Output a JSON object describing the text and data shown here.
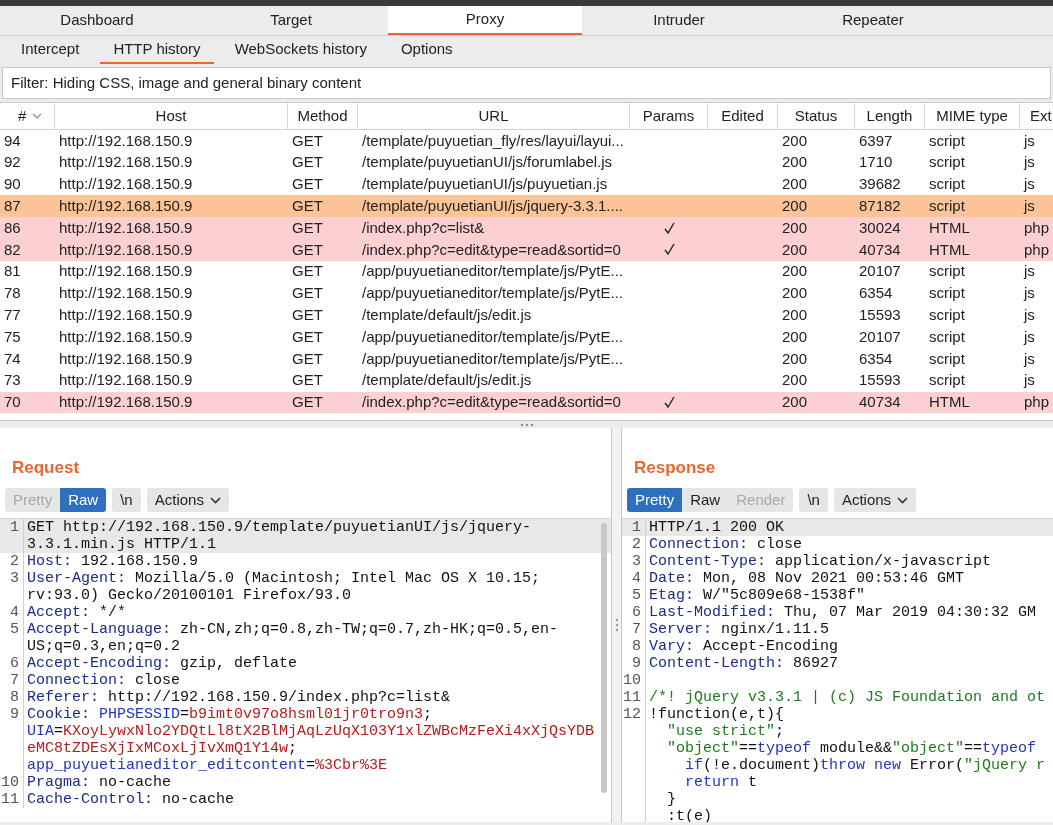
{
  "main_tabs": [
    {
      "label": "Dashboard",
      "selected": false
    },
    {
      "label": "Target",
      "selected": false
    },
    {
      "label": "Proxy",
      "selected": true
    },
    {
      "label": "Intruder",
      "selected": false
    },
    {
      "label": "Repeater",
      "selected": false
    }
  ],
  "sub_tabs": [
    {
      "label": "Intercept",
      "selected": false
    },
    {
      "label": "HTTP history",
      "selected": true
    },
    {
      "label": "WebSockets history",
      "selected": false
    },
    {
      "label": "Options",
      "selected": false
    }
  ],
  "filter": "Filter: Hiding CSS, image and general binary content",
  "table": {
    "columns": [
      "#",
      "Host",
      "Method",
      "URL",
      "Params",
      "Edited",
      "Status",
      "Length",
      "MIME type",
      "Ext"
    ],
    "rows": [
      {
        "id": "94",
        "host": "http://192.168.150.9",
        "method": "GET",
        "url": "/template/puyuetian_fly/res/layui/layui...",
        "params": false,
        "status": "200",
        "length": "6397",
        "mime": "script",
        "ext": "js",
        "color": "#ffffff"
      },
      {
        "id": "92",
        "host": "http://192.168.150.9",
        "method": "GET",
        "url": "/template/puyuetianUI/js/forumlabel.js",
        "params": false,
        "status": "200",
        "length": "1710",
        "mime": "script",
        "ext": "js",
        "color": "#ffffff"
      },
      {
        "id": "90",
        "host": "http://192.168.150.9",
        "method": "GET",
        "url": "/template/puyuetianUI/js/puyuetian.js",
        "params": false,
        "status": "200",
        "length": "39682",
        "mime": "script",
        "ext": "js",
        "color": "#ffffff"
      },
      {
        "id": "87",
        "host": "http://192.168.150.9",
        "method": "GET",
        "url": "/template/puyuetianUI/js/jquery-3.3.1....",
        "params": false,
        "status": "200",
        "length": "87182",
        "mime": "script",
        "ext": "js",
        "color": "#fcc396"
      },
      {
        "id": "86",
        "host": "http://192.168.150.9",
        "method": "GET",
        "url": "/index.php?c=list&",
        "params": true,
        "status": "200",
        "length": "30024",
        "mime": "HTML",
        "ext": "php",
        "color": "#fcd0d0"
      },
      {
        "id": "82",
        "host": "http://192.168.150.9",
        "method": "GET",
        "url": "/index.php?c=edit&type=read&sortid=0",
        "params": true,
        "status": "200",
        "length": "40734",
        "mime": "HTML",
        "ext": "php",
        "color": "#fcd0d0"
      },
      {
        "id": "81",
        "host": "http://192.168.150.9",
        "method": "GET",
        "url": "/app/puyuetianeditor/template/js/PytE...",
        "params": false,
        "status": "200",
        "length": "20107",
        "mime": "script",
        "ext": "js",
        "color": "#ffffff"
      },
      {
        "id": "78",
        "host": "http://192.168.150.9",
        "method": "GET",
        "url": "/app/puyuetianeditor/template/js/PytE...",
        "params": false,
        "status": "200",
        "length": "6354",
        "mime": "script",
        "ext": "js",
        "color": "#ffffff"
      },
      {
        "id": "77",
        "host": "http://192.168.150.9",
        "method": "GET",
        "url": "/template/default/js/edit.js",
        "params": false,
        "status": "200",
        "length": "15593",
        "mime": "script",
        "ext": "js",
        "color": "#ffffff"
      },
      {
        "id": "75",
        "host": "http://192.168.150.9",
        "method": "GET",
        "url": "/app/puyuetianeditor/template/js/PytE...",
        "params": false,
        "status": "200",
        "length": "20107",
        "mime": "script",
        "ext": "js",
        "color": "#ffffff"
      },
      {
        "id": "74",
        "host": "http://192.168.150.9",
        "method": "GET",
        "url": "/app/puyuetianeditor/template/js/PytE...",
        "params": false,
        "status": "200",
        "length": "6354",
        "mime": "script",
        "ext": "js",
        "color": "#ffffff"
      },
      {
        "id": "73",
        "host": "http://192.168.150.9",
        "method": "GET",
        "url": "/template/default/js/edit.js",
        "params": false,
        "status": "200",
        "length": "15593",
        "mime": "script",
        "ext": "js",
        "color": "#ffffff"
      },
      {
        "id": "70",
        "host": "http://192.168.150.9",
        "method": "GET",
        "url": "/index.php?c=edit&type=read&sortid=0",
        "params": true,
        "status": "200",
        "length": "40734",
        "mime": "HTML",
        "ext": "php",
        "color": "#fcd0d0"
      }
    ]
  },
  "panes": [
    {
      "title": "Request",
      "buttons": [
        {
          "label": "Pretty",
          "selected": false,
          "disabled": true
        },
        {
          "label": "Raw",
          "selected": true,
          "disabled": false
        },
        {
          "label": "\\n",
          "selected": false,
          "disabled": false
        },
        {
          "label": "Actions",
          "selected": false,
          "disabled": false,
          "dropdown": true
        }
      ],
      "wrap": true,
      "lines": [
        {
          "number": "1",
          "parts": [
            {
              "kind": "plain",
              "text": "GET http://192.168.150.9/template/puyuetianUI/js/jquery-3.3.1.min.js HTTP/1.1"
            }
          ]
        },
        {
          "number": "2",
          "parts": [
            {
              "kind": "header",
              "text": "Host:"
            },
            {
              "kind": "plain",
              "text": " 192.168.150.9"
            }
          ]
        },
        {
          "number": "3",
          "parts": [
            {
              "kind": "header",
              "text": "User-Agent:"
            },
            {
              "kind": "plain",
              "text": " Mozilla/5.0 (Macintosh; Intel Mac OS X 10.15; rv:93.0) Gecko/20100101 Firefox/93.0"
            }
          ]
        },
        {
          "number": "4",
          "parts": [
            {
              "kind": "header",
              "text": "Accept:"
            },
            {
              "kind": "plain",
              "text": " */*"
            }
          ]
        },
        {
          "number": "5",
          "parts": [
            {
              "kind": "header",
              "text": "Accept-Language:"
            },
            {
              "kind": "plain",
              "text": " zh-CN,zh;q=0.8,zh-TW;q=0.7,zh-HK;q=0.5,en-US;q=0.3,en;q=0.2"
            }
          ]
        },
        {
          "number": "6",
          "parts": [
            {
              "kind": "header",
              "text": "Accept-Encoding:"
            },
            {
              "kind": "plain",
              "text": " gzip, deflate"
            }
          ]
        },
        {
          "number": "7",
          "parts": [
            {
              "kind": "header",
              "text": "Connection:"
            },
            {
              "kind": "plain",
              "text": " close"
            }
          ]
        },
        {
          "number": "8",
          "parts": [
            {
              "kind": "header",
              "text": "Referer:"
            },
            {
              "kind": "plain",
              "text": " http://192.168.150.9/index.php?c=list&"
            }
          ]
        },
        {
          "number": "9",
          "parts": [
            {
              "kind": "header",
              "text": "Cookie:"
            },
            {
              "kind": "cookie_name",
              "text": " PHPSESSID"
            },
            {
              "kind": "plain",
              "text": "="
            },
            {
              "kind": "cookie_value",
              "text": "b9imt0v97o8hsml01jr0tro9n3"
            },
            {
              "kind": "plain",
              "text": "; "
            },
            {
              "kind": "cookie_name",
              "text": "UIA"
            },
            {
              "kind": "plain",
              "text": "="
            },
            {
              "kind": "cookie_value",
              "text": "KXoyLywxNlo2YDQtLl8tX2BlMjAqLzUqX103Y1xlZWBcMzFeXi4xXjQsYDBeMC8tZDEsXjIxMCoxLjIvXmQ1Y14w"
            },
            {
              "kind": "plain",
              "text": "; "
            },
            {
              "kind": "cookie_name",
              "text": "app_puyuetianeditor_editcontent"
            },
            {
              "kind": "plain",
              "text": "="
            },
            {
              "kind": "cookie_value",
              "text": "%3Cbr%3E"
            }
          ]
        },
        {
          "number": "10",
          "parts": [
            {
              "kind": "header",
              "text": "Pragma:"
            },
            {
              "kind": "plain",
              "text": " no-cache"
            }
          ]
        },
        {
          "number": "11",
          "parts": [
            {
              "kind": "header",
              "text": "Cache-Control:"
            },
            {
              "kind": "plain",
              "text": " no-cache"
            }
          ]
        }
      ]
    },
    {
      "title": "Response",
      "buttons": [
        {
          "label": "Pretty",
          "selected": true,
          "disabled": false
        },
        {
          "label": "Raw",
          "selected": false,
          "disabled": false
        },
        {
          "label": "Render",
          "selected": false,
          "disabled": true
        },
        {
          "label": "\\n",
          "selected": false,
          "disabled": false
        },
        {
          "label": "Actions",
          "selected": false,
          "disabled": false,
          "dropdown": true
        }
      ],
      "wrap": false,
      "lines": [
        {
          "number": "1",
          "parts": [
            {
              "kind": "plain",
              "text": "HTTP/1.1 200 OK"
            }
          ]
        },
        {
          "number": "2",
          "parts": [
            {
              "kind": "header",
              "text": "Connection:"
            },
            {
              "kind": "plain",
              "text": " close"
            }
          ]
        },
        {
          "number": "3",
          "parts": [
            {
              "kind": "header",
              "text": "Content-Type:"
            },
            {
              "kind": "plain",
              "text": " application/x-javascript"
            }
          ]
        },
        {
          "number": "4",
          "parts": [
            {
              "kind": "header",
              "text": "Date:"
            },
            {
              "kind": "plain",
              "text": " Mon, 08 Nov 2021 00:53:46 GMT"
            }
          ]
        },
        {
          "number": "5",
          "parts": [
            {
              "kind": "header",
              "text": "Etag:"
            },
            {
              "kind": "plain",
              "text": " W/\"5c809e68-1538f\""
            }
          ]
        },
        {
          "number": "6",
          "parts": [
            {
              "kind": "header",
              "text": "Last-Modified:"
            },
            {
              "kind": "plain",
              "text": " Thu, 07 Mar 2019 04:30:32 GM"
            }
          ]
        },
        {
          "number": "7",
          "parts": [
            {
              "kind": "header",
              "text": "Server:"
            },
            {
              "kind": "plain",
              "text": " nginx/1.11.5"
            }
          ]
        },
        {
          "number": "8",
          "parts": [
            {
              "kind": "header",
              "text": "Vary:"
            },
            {
              "kind": "plain",
              "text": " Accept-Encoding"
            }
          ]
        },
        {
          "number": "9",
          "parts": [
            {
              "kind": "header",
              "text": "Content-Length:"
            },
            {
              "kind": "plain",
              "text": " 86927"
            }
          ]
        },
        {
          "number": "10"
        },
        {
          "number": "11",
          "parts": [
            {
              "kind": "comment",
              "text": "/*! jQuery v3.3.1 | (c) JS Foundation and ot"
            }
          ]
        },
        {
          "number": "12",
          "parts": [
            {
              "kind": "plain",
              "text": "!function(e,t){"
            }
          ]
        },
        {
          "parts": [
            {
              "kind": "string",
              "text": "  \"use strict\""
            },
            {
              "kind": "plain",
              "text": ";"
            }
          ]
        },
        {
          "parts": [
            {
              "kind": "string",
              "text": "  \"object\""
            },
            {
              "kind": "plain",
              "text": "=="
            },
            {
              "kind": "keyword",
              "text": "typeof"
            },
            {
              "kind": "plain",
              "text": " module&&"
            },
            {
              "kind": "string",
              "text": "\"object\""
            },
            {
              "kind": "plain",
              "text": "=="
            },
            {
              "kind": "keyword",
              "text": "typeof"
            }
          ]
        },
        {
          "parts": [
            {
              "kind": "keyword",
              "text": "    if"
            },
            {
              "kind": "plain",
              "text": "(!e.document)"
            },
            {
              "kind": "keyword",
              "text": "throw new"
            },
            {
              "kind": "plain",
              "text": " Error("
            },
            {
              "kind": "string",
              "text": "\"jQuery r"
            }
          ]
        },
        {
          "parts": [
            {
              "kind": "keyword",
              "text": "    return"
            },
            {
              "kind": "plain",
              "text": " t"
            }
          ]
        },
        {
          "parts": [
            {
              "kind": "plain",
              "text": "  }"
            }
          ]
        },
        {
          "parts": [
            {
              "kind": "plain",
              "text": "  :t(e)"
            }
          ]
        }
      ]
    }
  ]
}
